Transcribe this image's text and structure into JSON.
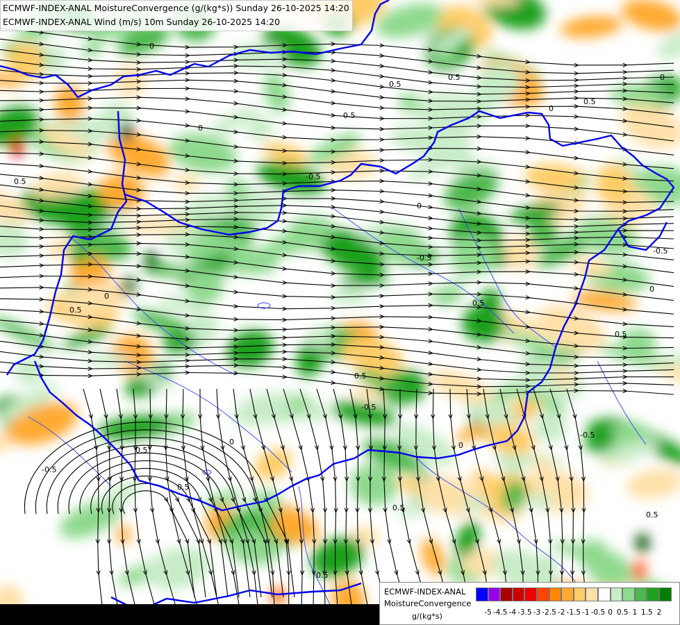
{
  "title_lines": [
    "ECMWF-INDEX-ANAL MoistureConvergence (g/(kg*s)) Sunday 26-10-2025 14:20",
    "ECMWF-INDEX-ANAL Wind (m/s) 10m Sunday 26-10-2025 14:20"
  ],
  "legend": {
    "name_line1": "ECMWF-INDEX-ANAL",
    "name_line2": "MoistureConvergence",
    "unit": "g/(kg*s)",
    "tick_labels": [
      "-5",
      "-4.5",
      "-4",
      "-3.5",
      "-3",
      "-2.5",
      "-2",
      "-1.5",
      "-1",
      "-0.5",
      "0",
      "0.5",
      "1",
      "1.5",
      "2"
    ],
    "colors": [
      "#0000ff",
      "#9900ee",
      "#aa0000",
      "#cc0000",
      "#ee0000",
      "#ff4400",
      "#ff8800",
      "#ffaa33",
      "#ffcc66",
      "#ffe0a8",
      "#ffffff",
      "#c7ecc7",
      "#8ed98e",
      "#4db84d",
      "#1fa01f",
      "#008000"
    ]
  },
  "contour_labels": [
    "0",
    "0.5",
    "-0.5",
    "0",
    "0.5",
    "-0.5",
    "0.5",
    "0",
    "-0.5",
    "0.5",
    "0",
    "0.5",
    "-0.5",
    "0.5",
    "0",
    "0.5",
    "-0.5",
    "0.5",
    "0",
    "0.5",
    "-0.5",
    "0.5",
    "0",
    "0.5",
    "0",
    "-0.5",
    "0.5",
    "0",
    "0.5"
  ],
  "colors": {
    "border": "#0000ee",
    "river": "#3344ff",
    "streamline": "#000000"
  }
}
